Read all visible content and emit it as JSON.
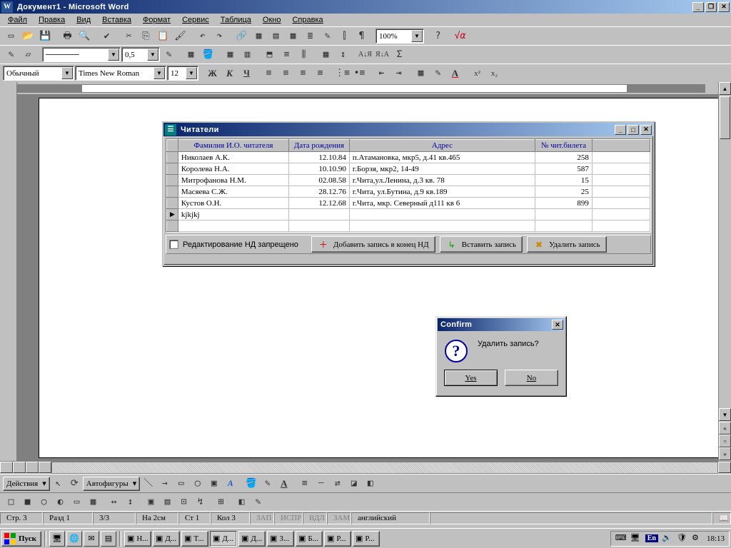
{
  "app": {
    "title": "Документ1 - Microsoft Word",
    "icon_letter": "W"
  },
  "menu": {
    "items": [
      "Файл",
      "Правка",
      "Вид",
      "Вставка",
      "Формат",
      "Сервис",
      "Таблица",
      "Окно",
      "Справка"
    ]
  },
  "fmt": {
    "style": "Обычный",
    "font": "Times New Roman",
    "size": "12",
    "zoom": "100%",
    "linew": "0,5"
  },
  "readers_window": {
    "title": "Читатели",
    "columns": [
      "Фамилия И.О. читателя",
      "Дата рождения",
      "Адрес",
      "№ чит.билета"
    ],
    "rows": [
      {
        "fio": "Николаев А.К.",
        "dob": "12.10.84",
        "addr": "п.Атамановка, мкр5, д.41 кв.465",
        "card": "258"
      },
      {
        "fio": "Королева Н.А.",
        "dob": "10.10.90",
        "addr": "г.Борзя, мкр2, 14-49",
        "card": "587"
      },
      {
        "fio": "Митрофанова Н.М.",
        "dob": "02.08.58",
        "addr": "г.Чита,ул.Ленина, д.3 кв. 78",
        "card": "15"
      },
      {
        "fio": "Масяева С.Ж.",
        "dob": "28.12.76",
        "addr": "г.Чита, ул.Бутина, д.9 кв.189",
        "card": "25"
      },
      {
        "fio": "Кустов О.Н.",
        "dob": "12.12.68",
        "addr": "г.Чита, мкр. Северный д111 кв 6",
        "card": "899"
      }
    ],
    "edit_row": {
      "fio": "kjkjkj"
    },
    "lock_label": "Редактирование НД запрещено",
    "btn_append": "Добавить запись в конец НД",
    "btn_insert": "Вставить запись",
    "btn_delete": "Удалить запись"
  },
  "confirm": {
    "title": "Confirm",
    "message": "Удалить запись?",
    "yes": "Yes",
    "no": "No"
  },
  "drawing": {
    "actions": "Действия",
    "autoshapes": "Автофигуры"
  },
  "status": {
    "page": "Стр. 3",
    "section": "Разд 1",
    "pages": "3/3",
    "at": "На 2см",
    "line": "Ст 1",
    "col": "Кол 3",
    "flags": [
      "ЗАП",
      "ИСПР",
      "ВДЛ",
      "ЗАМ"
    ],
    "lang": "английский"
  },
  "taskbar": {
    "start": "Пуск",
    "buttons": [
      "Н...",
      "Д...",
      "T...",
      "Д...",
      "Д...",
      "3...",
      "Б...",
      "P...",
      "P..."
    ],
    "lang": "En",
    "clock": "18:13"
  }
}
